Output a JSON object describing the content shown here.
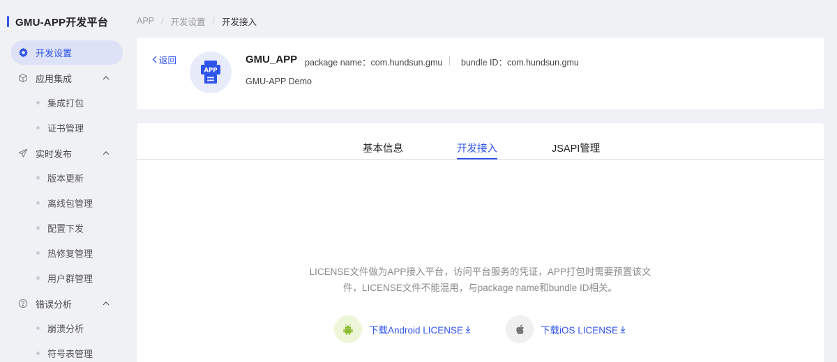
{
  "sidebar": {
    "brand": "GMU-APP开发平台",
    "active_item": "开发设置",
    "groups": [
      {
        "label": "应用集成",
        "items": [
          "集成打包",
          "证书管理"
        ]
      },
      {
        "label": "实时发布",
        "items": [
          "版本更新",
          "离线包管理",
          "配置下发",
          "热修复管理",
          "用户群管理"
        ]
      },
      {
        "label": "错误分析",
        "items": [
          "崩溃分析",
          "符号表管理"
        ]
      }
    ]
  },
  "breadcrumb": [
    "APP",
    "开发设置",
    "开发接入"
  ],
  "header": {
    "back_label": "返回",
    "avatar_text": "APP",
    "app_name": "GMU_APP",
    "package_name": "package name：com.hundsun.gmu",
    "bundle_id": "bundle ID：com.hundsun.gmu",
    "description": "GMU-APP Demo"
  },
  "tabs": [
    {
      "label": "基本信息",
      "active": false
    },
    {
      "label": "开发接入",
      "active": true
    },
    {
      "label": "JSAPI管理",
      "active": false
    }
  ],
  "content": {
    "notice_line1": "LICENSE文件做为APP接入平台，访问平台服务的凭证，APP打包时需要预置该文",
    "notice_line2": "件，LICENSE文件不能混用，与package name和bundle ID相关。",
    "download_android": "下载Android LICENSE",
    "download_ios": "下载iOS LICENSE"
  },
  "colors": {
    "accent": "#2f54eb",
    "android_bg": "#eef6d9",
    "android_icon": "#8ab82e",
    "ios_bg": "#f0f0f0"
  }
}
